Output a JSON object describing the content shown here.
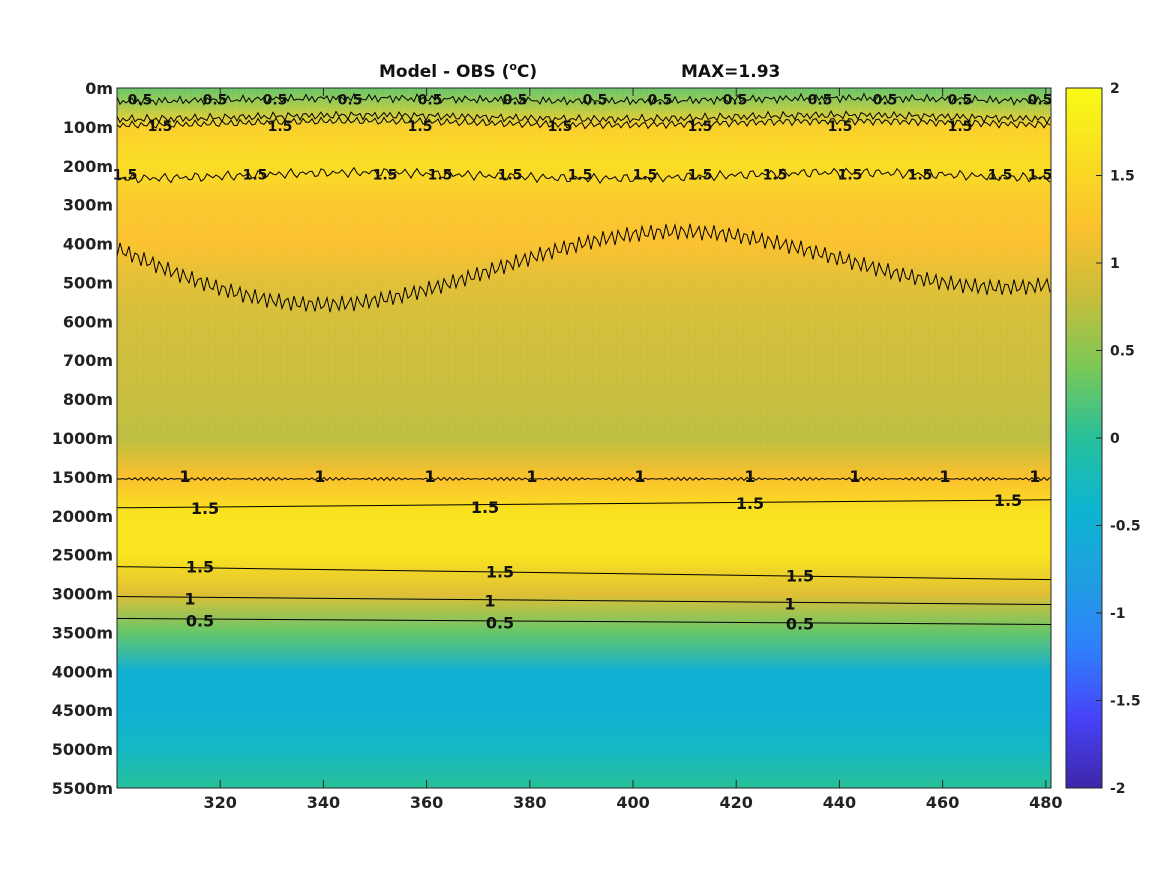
{
  "chart_data": {
    "type": "heatmap",
    "title": "Model - OBS (",
    "title_sup": "o",
    "title_unit": "C)",
    "max_label": "MAX=1.93",
    "x_ticks": [
      "320",
      "340",
      "360",
      "380",
      "400",
      "420",
      "440",
      "460",
      "480"
    ],
    "x_tick_values": [
      320,
      340,
      360,
      380,
      400,
      420,
      440,
      460,
      480
    ],
    "xlim": [
      300,
      481
    ],
    "y_ticks": [
      "0m",
      "100m",
      "200m",
      "300m",
      "400m",
      "500m",
      "600m",
      "700m",
      "800m",
      "1000m",
      "1500m",
      "2000m",
      "2500m",
      "3000m",
      "3500m",
      "4000m",
      "4500m",
      "5000m",
      "5500m"
    ],
    "colorbar": {
      "min": -2,
      "max": 2,
      "ticks": [
        "2",
        "1.5",
        "1",
        "0.5",
        "0",
        "-0.5",
        "-1",
        "-1.5",
        "-2"
      ],
      "tick_values": [
        2,
        1.5,
        1,
        0.5,
        0,
        -0.5,
        -1,
        -1.5,
        -2
      ],
      "colormap": [
        "#3e26a8",
        "#4743f8",
        "#2f80fb",
        "#1f9fe0",
        "#0db5d1",
        "#27c09a",
        "#7ac858",
        "#c7bd3c",
        "#fbc12e",
        "#f9dd22",
        "#f9fb15"
      ]
    },
    "depth_profile": [
      {
        "depth": "0m",
        "value": 0.3
      },
      {
        "depth": "100m",
        "value": 1.4
      },
      {
        "depth": "200m",
        "value": 1.6
      },
      {
        "depth": "300m",
        "value": 1.3
      },
      {
        "depth": "400m",
        "value": 1.2
      },
      {
        "depth": "500m",
        "value": 1.0
      },
      {
        "depth": "600m",
        "value": 0.9
      },
      {
        "depth": "700m",
        "value": 0.85
      },
      {
        "depth": "800m",
        "value": 0.8
      },
      {
        "depth": "1000m",
        "value": 0.75
      },
      {
        "depth": "1500m",
        "value": 1.2
      },
      {
        "depth": "2000m",
        "value": 1.7
      },
      {
        "depth": "2500m",
        "value": 1.7
      },
      {
        "depth": "3000m",
        "value": 1.0
      },
      {
        "depth": "3500m",
        "value": 0.3
      },
      {
        "depth": "4000m",
        "value": -0.5
      },
      {
        "depth": "4500m",
        "value": -0.5
      },
      {
        "depth": "5000m",
        "value": -0.3
      },
      {
        "depth": "5500m",
        "value": 0.0
      }
    ],
    "contour_labels": [
      "0.5",
      "1",
      "1.5"
    ]
  }
}
